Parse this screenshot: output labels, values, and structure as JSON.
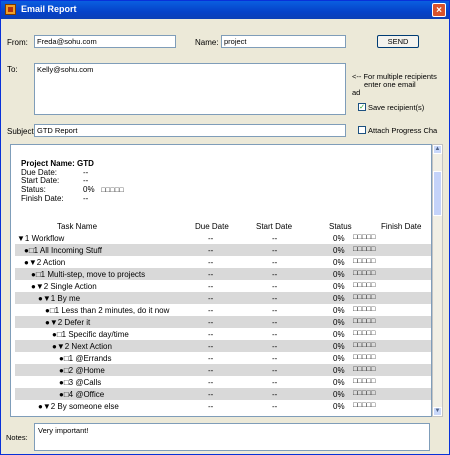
{
  "window": {
    "title": "Email Report"
  },
  "form": {
    "from_label": "From:",
    "from_value": "Freda@sohu.com",
    "name_label": "Name:",
    "name_value": "project",
    "send_label": "SEND",
    "to_label": "To:",
    "to_value": "Kelly@sohu.com",
    "note_line1": "<-- For multiple recipients",
    "note_line2": "enter one email",
    "note_line3": "ad",
    "save_recipients_label": "Save recipient(s)",
    "save_recipients_checked": true,
    "subject_label": "Subject:",
    "subject_value": "GTD Report",
    "attach_label": "Attach Progress Cha",
    "attach_checked": false
  },
  "report": {
    "project_name": "Project Name: GTD",
    "due_date_label": "Due Date:",
    "due_date_value": "--",
    "start_date_label": "Start Date:",
    "start_date_value": "--",
    "status_label": "Status:",
    "status_value": "0%",
    "status_boxes": "□□□□□",
    "finish_date_label": "Finish Date:",
    "finish_date_value": "--",
    "columns": [
      "Task Name",
      "Due Date",
      "Start Date",
      "Status",
      "Finish Date"
    ],
    "rows": [
      {
        "task": "▼1 Workflow",
        "indent": 0,
        "due": "--",
        "start": "--",
        "status": "0%",
        "boxes": "□□□□□"
      },
      {
        "task": "●□1 All Incoming Stuff",
        "indent": 1,
        "due": "--",
        "start": "--",
        "status": "0%",
        "boxes": "□□□□□"
      },
      {
        "task": "●▼2 Action",
        "indent": 1,
        "due": "--",
        "start": "--",
        "status": "0%",
        "boxes": "□□□□□"
      },
      {
        "task": "●□1 Multi-step, move to projects",
        "indent": 2,
        "due": "--",
        "start": "--",
        "status": "0%",
        "boxes": "□□□□□"
      },
      {
        "task": "●▼2 Single Action",
        "indent": 2,
        "due": "--",
        "start": "--",
        "status": "0%",
        "boxes": "□□□□□"
      },
      {
        "task": "●▼1 By me",
        "indent": 3,
        "due": "--",
        "start": "--",
        "status": "0%",
        "boxes": "□□□□□"
      },
      {
        "task": "●□1 Less than 2 minutes, do it now",
        "indent": 4,
        "due": "--",
        "start": "--",
        "status": "0%",
        "boxes": "□□□□□"
      },
      {
        "task": "●▼2 Defer it",
        "indent": 4,
        "due": "--",
        "start": "--",
        "status": "0%",
        "boxes": "□□□□□"
      },
      {
        "task": "●□1 Specific day/time",
        "indent": 5,
        "due": "--",
        "start": "--",
        "status": "0%",
        "boxes": "□□□□□"
      },
      {
        "task": "●▼2 Next Action",
        "indent": 5,
        "due": "--",
        "start": "--",
        "status": "0%",
        "boxes": "□□□□□"
      },
      {
        "task": "●□1 @Errands",
        "indent": 6,
        "due": "--",
        "start": "--",
        "status": "0%",
        "boxes": "□□□□□"
      },
      {
        "task": "●□2 @Home",
        "indent": 6,
        "due": "--",
        "start": "--",
        "status": "0%",
        "boxes": "□□□□□"
      },
      {
        "task": "●□3 @Calls",
        "indent": 6,
        "due": "--",
        "start": "--",
        "status": "0%",
        "boxes": "□□□□□"
      },
      {
        "task": "●□4 @Office",
        "indent": 6,
        "due": "--",
        "start": "--",
        "status": "0%",
        "boxes": "□□□□□"
      },
      {
        "task": "●▼2 By someone else",
        "indent": 3,
        "due": "--",
        "start": "--",
        "status": "0%",
        "boxes": "□□□□□"
      }
    ]
  },
  "notes": {
    "label": "Notes:",
    "value": "Very important!"
  },
  "icons": {
    "app": "report-icon",
    "close": "close-icon",
    "scroll_up": "chevron-up-icon",
    "scroll_down": "chevron-down-icon"
  },
  "colors": {
    "titlebar": "#0A5FE0",
    "window_bg": "#ECE9D8",
    "row_alt": "#D9D9D9",
    "close": "#D9532C"
  }
}
